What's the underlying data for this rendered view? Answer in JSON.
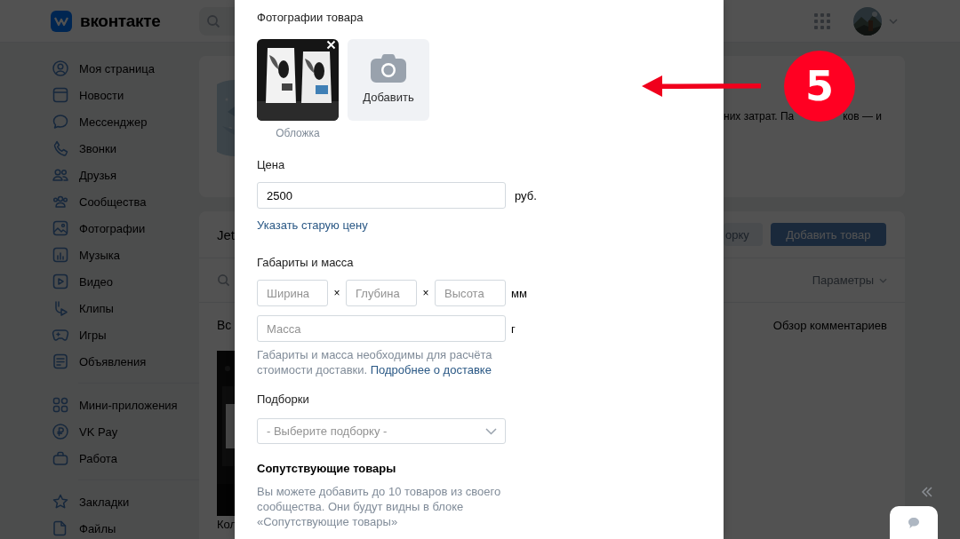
{
  "header": {
    "logo": "вконтакте"
  },
  "sidebar": {
    "groups": [
      {
        "items": [
          {
            "label": "Моя страница"
          },
          {
            "label": "Новости"
          },
          {
            "label": "Мессенджер"
          },
          {
            "label": "Звонки"
          },
          {
            "label": "Друзья"
          },
          {
            "label": "Сообщества"
          },
          {
            "label": "Фотографии"
          },
          {
            "label": "Музыка"
          },
          {
            "label": "Видео"
          },
          {
            "label": "Клипы"
          },
          {
            "label": "Игры"
          },
          {
            "label": "Объявления"
          }
        ]
      },
      {
        "items": [
          {
            "label": "Мини-приложения"
          },
          {
            "label": "VK Pay"
          },
          {
            "label": "Работа"
          }
        ]
      },
      {
        "items": [
          {
            "label": "Закладки"
          },
          {
            "label": "Файлы"
          }
        ]
      }
    ]
  },
  "background": {
    "cover_card": {
      "description_parts": [
        "них затрат. Па",
        "ков — и"
      ]
    },
    "goods_card": {
      "title": "Jet",
      "buttons": [
        "орку",
        "Добавить товар"
      ],
      "filter_label": "Параметры",
      "tab": "Вс",
      "link": "Обзор комментариев",
      "item_title": "Кол"
    }
  },
  "modal": {
    "photos": {
      "label": "Фотографии товара",
      "cover_caption": "Обложка",
      "add_label": "Добавить"
    },
    "price": {
      "label": "Цена",
      "value": "2500",
      "unit": "руб.",
      "old_price_link": "Указать старую цену"
    },
    "dimensions": {
      "label": "Габариты и масса",
      "fields": [
        {
          "placeholder": "Ширина"
        },
        {
          "placeholder": "Глубина"
        },
        {
          "placeholder": "Высота"
        }
      ],
      "separators": [
        "×",
        "×"
      ],
      "unit": "мм",
      "mass": {
        "placeholder": "Масса",
        "unit": "г"
      },
      "hint": "Габариты и масса необходимы для расчёта стоимости доставки.",
      "hint_link": "Подробнее о доставке"
    },
    "collections": {
      "label": "Подборки",
      "placeholder": "- Выберите подборку -"
    },
    "related": {
      "label": "Сопутствующие товары",
      "hint": "Вы можете добавить до 10 товаров из своего сообщества. Они будут видны в блоке «Сопутствующие товары»"
    }
  },
  "annotation": {
    "step": "5"
  }
}
